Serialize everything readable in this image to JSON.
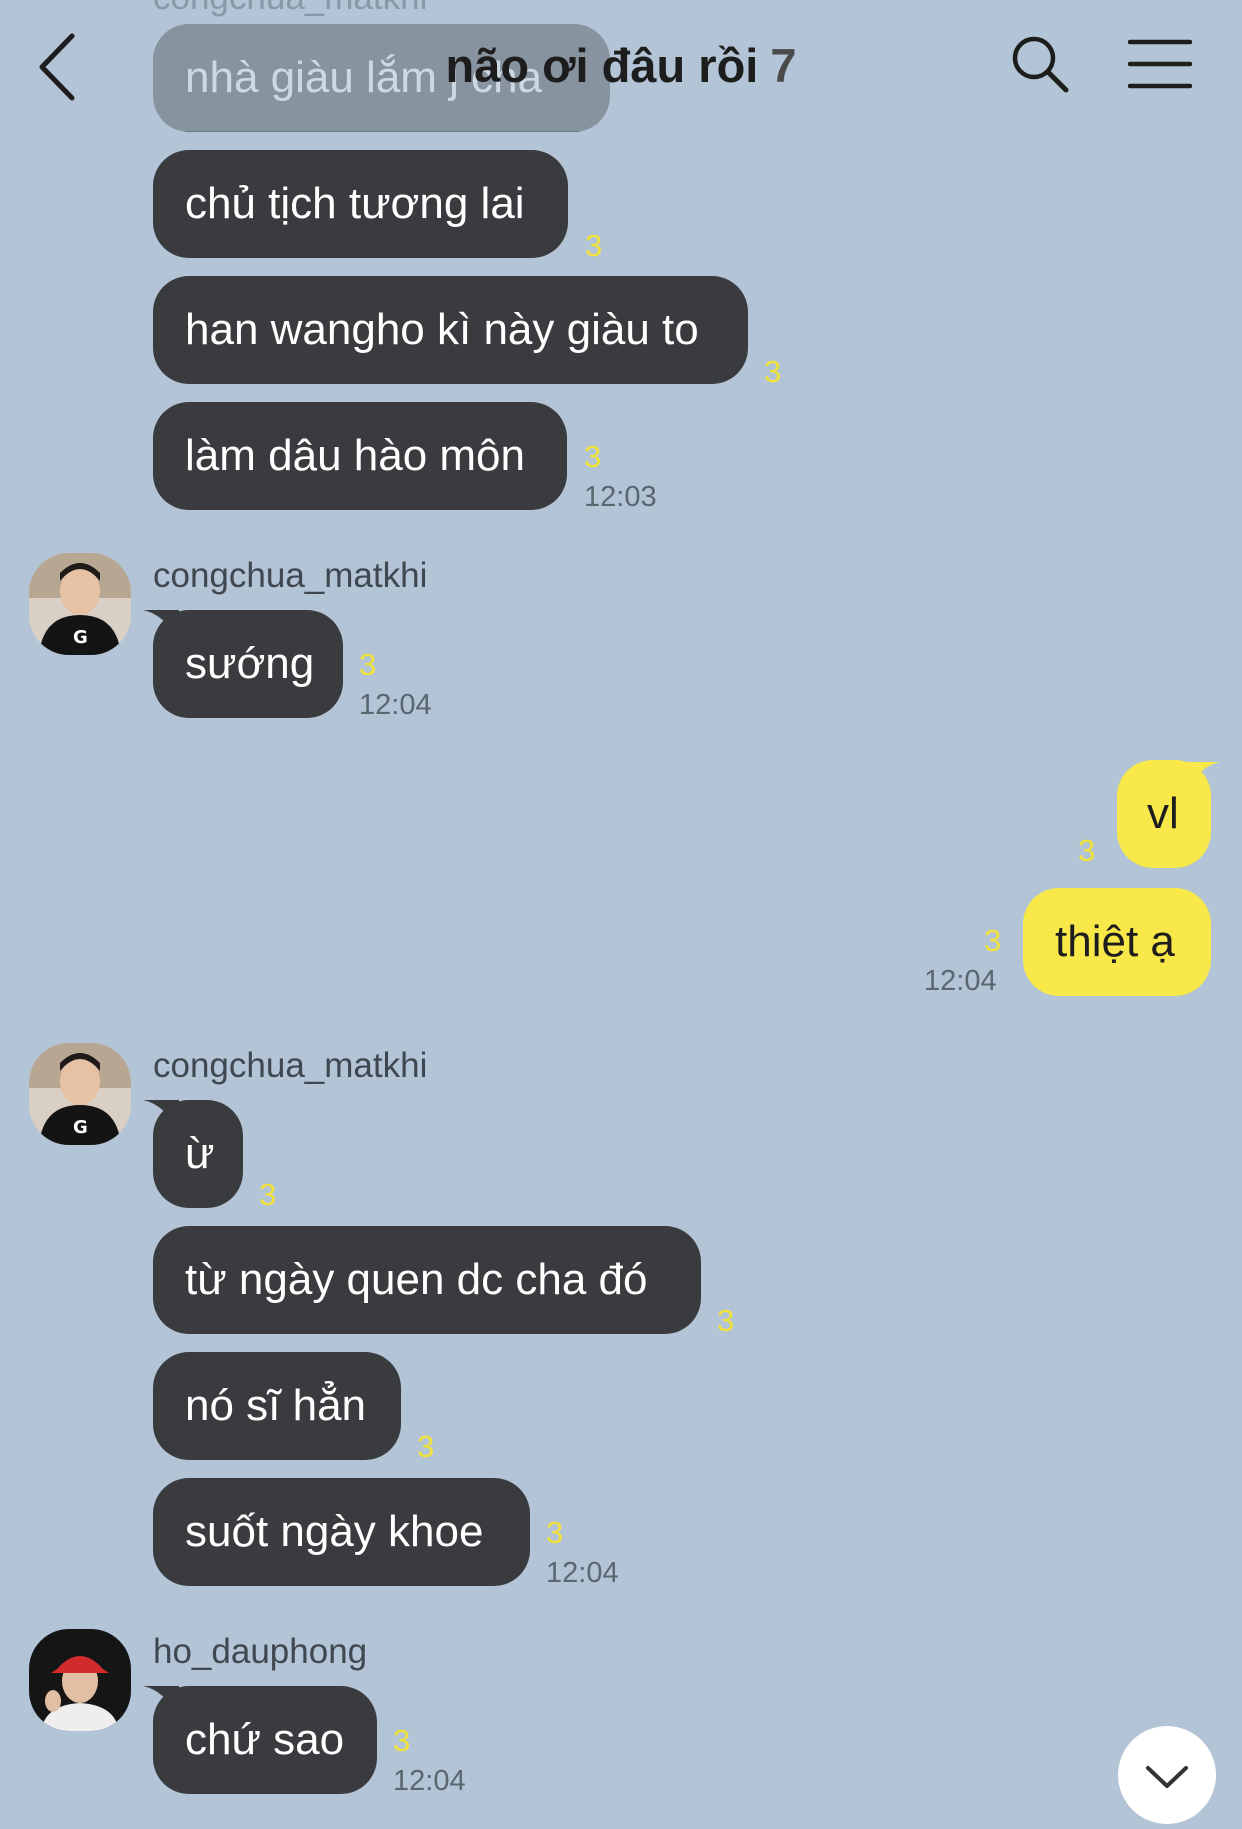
{
  "header": {
    "title": "não ơi đâu rồi",
    "member_count": "7"
  },
  "messages": {
    "m0": {
      "text": "nhà giàu lắm j cha",
      "sender": "congchua_matkhi"
    },
    "m1": {
      "text": "chủ tịch tương lai",
      "unread": "3"
    },
    "m2": {
      "text": "han wangho kì này giàu to",
      "unread": "3"
    },
    "m3": {
      "text": "làm dâu hào môn",
      "unread": "3",
      "time": "12:03"
    },
    "m4": {
      "sender": "congchua_matkhi",
      "text": "sướng",
      "unread": "3",
      "time": "12:04"
    },
    "m5": {
      "text": "vl",
      "unread": "3"
    },
    "m6": {
      "text": "thiệt ạ",
      "unread": "3",
      "time": "12:04"
    },
    "m7": {
      "sender": "congchua_matkhi",
      "text": "ừ",
      "unread": "3"
    },
    "m8": {
      "text": "từ ngày quen dc cha đó",
      "unread": "3"
    },
    "m9": {
      "text": "nó sĩ hẳn",
      "unread": "3"
    },
    "m10": {
      "text": "suốt ngày khoe",
      "unread": "3",
      "time": "12:04"
    },
    "m11": {
      "sender": "ho_dauphong",
      "text": "chứ sao",
      "unread": "3",
      "time": "12:04"
    }
  },
  "icons": {
    "back": "back-arrow-icon",
    "search": "search-icon",
    "menu": "menu-icon",
    "scroll_down": "chevron-down-icon"
  },
  "colors": {
    "background": "#b2c4d5",
    "incoming_bubble": "#3a3b3e",
    "outgoing_bubble": "#f8e84a",
    "unread_count": "#f1e23a"
  }
}
